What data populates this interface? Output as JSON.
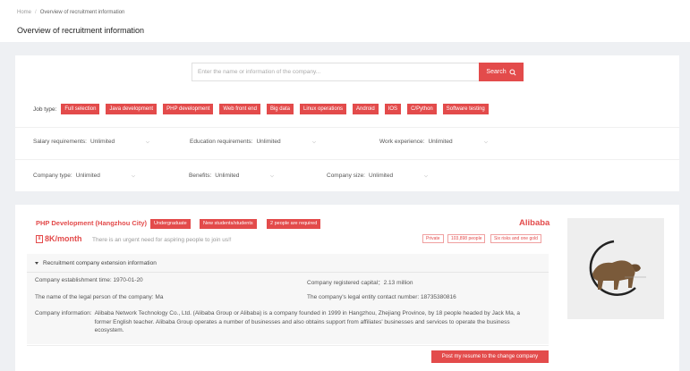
{
  "breadcrumb": {
    "home": "Home",
    "separator": "/",
    "current": "Overview of recruitment information"
  },
  "page": {
    "title": "Overview of recruitment information"
  },
  "search": {
    "placeholder": "Enter the name or information of the company...",
    "button_label": "Search",
    "icon": "search-icon"
  },
  "job_type": {
    "label": "Job type:",
    "tags": [
      "Full selection",
      "Java development",
      "PHP development",
      "Web front end",
      "Big data",
      "Linux operations",
      "Android",
      "IOS",
      "C/Python",
      "Software testing"
    ]
  },
  "filters_row1": [
    {
      "label": "Salary requirements:",
      "value": "Unlimited"
    },
    {
      "label": "Education requirements:",
      "value": "Unlimited"
    },
    {
      "label": "Work experience:",
      "value": "Unlimited"
    }
  ],
  "filters_row2": [
    {
      "label": "Company type:",
      "value": "Unlimited"
    },
    {
      "label": "Benefits:",
      "value": "Unlimited"
    },
    {
      "label": "Company size:",
      "value": "Unlimited"
    }
  ],
  "job": {
    "title": "PHP Development (Hangzhou City)",
    "badges": [
      "Undergraduate",
      "New students/students",
      "2 people are required"
    ],
    "salary": "8K/month",
    "salary_icon": "money-icon",
    "slogan": "There is an urgent need for aspiring people to join us!!",
    "company_name": "Alibaba",
    "company_tags": [
      "Private",
      "103,898 people",
      "Six risks and one gold"
    ],
    "extension_title": "Recruitment company extension information",
    "establishment": "Company establishment time:  1970-01-20",
    "capital": "Company registered capital：2.13 million",
    "legal_person": "The name of the legal person of the company:  Ma",
    "contact": "The company's legal entity contact number:  18735380816",
    "info_label": "Company information:",
    "info_text": "Alibaba Network Technology Co., Ltd. (Alibaba Group or Alibaba) is a company founded in 1999 in Hangzhou, Zhejiang Province, by 18 people headed by Jack Ma, a former English teacher. Alibaba Group operates a number of businesses and also obtains support from affiliates' businesses and services to operate the business ecosystem.",
    "post_button": "Post my resume to the change company"
  },
  "colors": {
    "accent": "#e34b4b",
    "background": "#eef0f3"
  }
}
